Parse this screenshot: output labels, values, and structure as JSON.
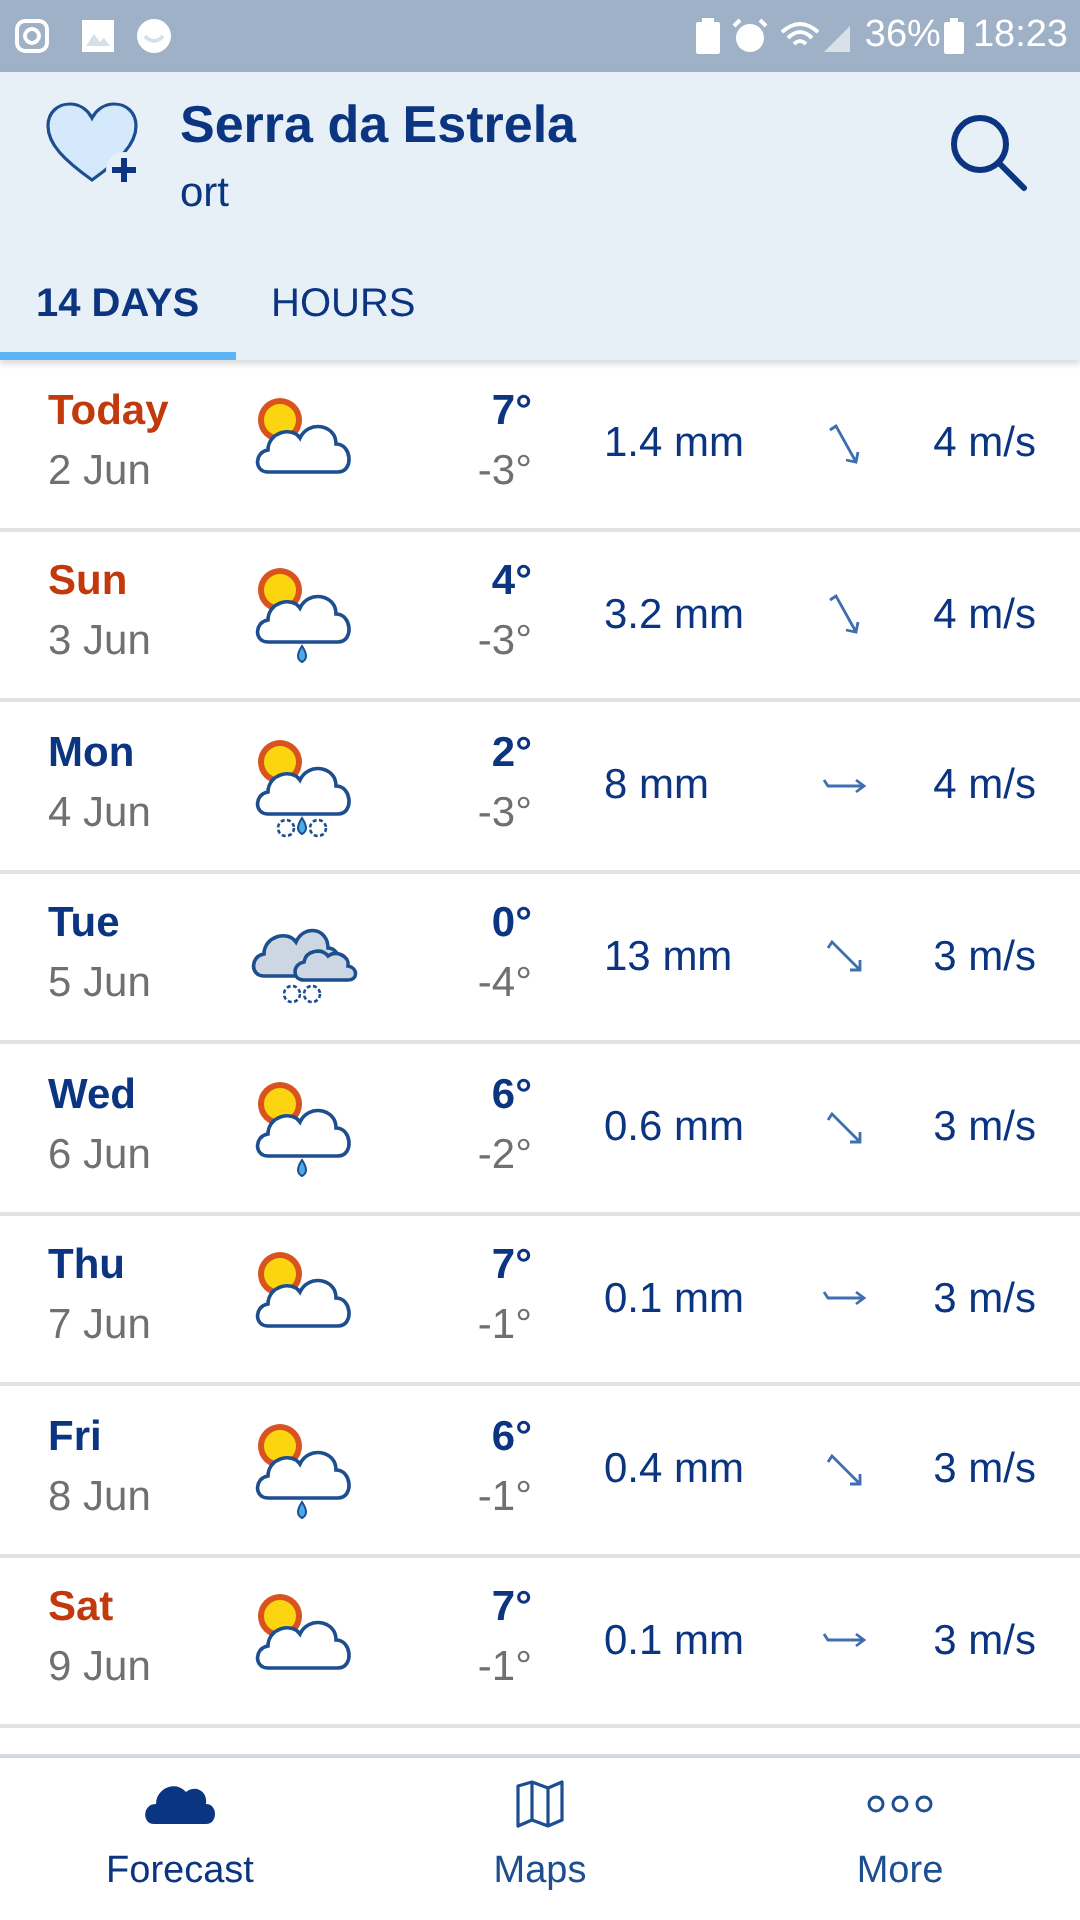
{
  "status_bar": {
    "battery": "36%",
    "time": "18:23"
  },
  "header": {
    "title": "Serra da Estrela",
    "subtitle": "ort"
  },
  "tabs": [
    {
      "label": "14 DAYS",
      "selected": true
    },
    {
      "label": "HOURS",
      "selected": false
    }
  ],
  "days": [
    {
      "day": "Today",
      "highlight": true,
      "date": "2 Jun",
      "kind": "sun_cloud",
      "high": "7°",
      "low": "-3°",
      "precip": "1.4 mm",
      "wind": {
        "kind": "sse",
        "speed": "4 m/s"
      }
    },
    {
      "day": "Sun",
      "highlight": true,
      "date": "3 Jun",
      "kind": "sun_cloud_rain",
      "high": "4°",
      "low": "-3°",
      "precip": "3.2 mm",
      "wind": {
        "kind": "sse",
        "speed": "4 m/s"
      }
    },
    {
      "day": "Mon",
      "highlight": false,
      "date": "4 Jun",
      "kind": "sun_cloud_sleet",
      "high": "2°",
      "low": "-3°",
      "precip": "8 mm",
      "wind": {
        "kind": "e",
        "speed": "4 m/s"
      }
    },
    {
      "day": "Tue",
      "highlight": false,
      "date": "5 Jun",
      "kind": "cloud_snow",
      "high": "0°",
      "low": "-4°",
      "precip": "13 mm",
      "wind": {
        "kind": "se",
        "speed": "3 m/s"
      }
    },
    {
      "day": "Wed",
      "highlight": false,
      "date": "6 Jun",
      "kind": "sun_cloud_rain",
      "high": "6°",
      "low": "-2°",
      "precip": "0.6 mm",
      "wind": {
        "kind": "se",
        "speed": "3 m/s"
      }
    },
    {
      "day": "Thu",
      "highlight": false,
      "date": "7 Jun",
      "kind": "sun_cloud",
      "high": "7°",
      "low": "-1°",
      "precip": "0.1 mm",
      "wind": {
        "kind": "e",
        "speed": "3 m/s"
      }
    },
    {
      "day": "Fri",
      "highlight": false,
      "date": "8 Jun",
      "kind": "sun_cloud_rain",
      "high": "6°",
      "low": "-1°",
      "precip": "0.4 mm",
      "wind": {
        "kind": "se",
        "speed": "3 m/s"
      }
    },
    {
      "day": "Sat",
      "highlight": true,
      "date": "9 Jun",
      "kind": "sun_cloud",
      "high": "7°",
      "low": "-1°",
      "precip": "0.1 mm",
      "wind": {
        "kind": "e",
        "speed": "3 m/s"
      }
    }
  ],
  "nav": [
    {
      "label": "Forecast",
      "selected": true
    },
    {
      "label": "Maps",
      "selected": false
    },
    {
      "label": "More",
      "selected": false
    }
  ]
}
